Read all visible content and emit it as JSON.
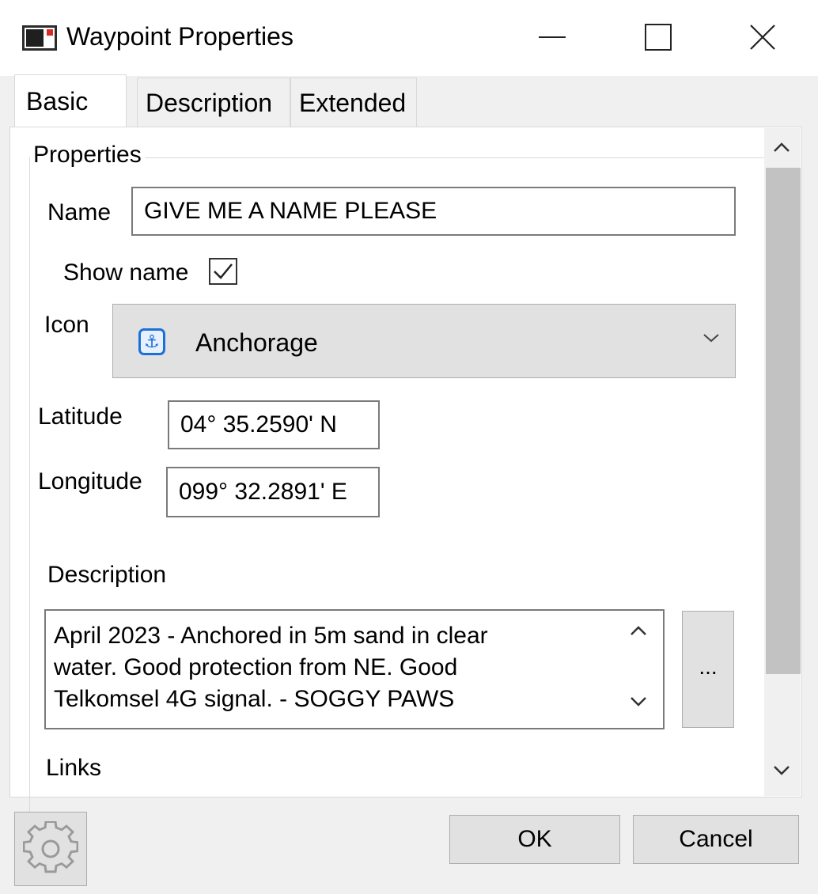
{
  "window": {
    "title": "Waypoint Properties",
    "app_icon": "waypoint-app-icon"
  },
  "title_controls": {
    "minimize": "minimize-icon",
    "maximize": "maximize-icon",
    "close": "close-icon"
  },
  "tabs": [
    {
      "label": "Basic",
      "active": true
    },
    {
      "label": "Description",
      "active": false
    },
    {
      "label": "Extended",
      "active": false
    }
  ],
  "properties": {
    "group_label": "Properties",
    "name_label": "Name",
    "name_value": "GIVE ME A NAME PLEASE",
    "show_name_label": "Show name",
    "show_name_checked": true,
    "icon_label": "Icon",
    "icon_value": "Anchorage",
    "icon_symbol": "anchor-icon",
    "latitude_label": "Latitude",
    "latitude_value": "04° 35.2590' N",
    "longitude_label": "Longitude",
    "longitude_value": "099° 32.2891' E",
    "description_label": "Description",
    "description_value": "April 2023 - Anchored in 5m sand in clear\nwater. Good protection from NE. Good\nTelkomsel 4G signal. - SOGGY PAWS",
    "more_button_label": "...",
    "links_label": "Links"
  },
  "footer": {
    "settings_icon": "gear-icon",
    "ok_label": "OK",
    "cancel_label": "Cancel"
  },
  "colors": {
    "window_bg": "#f0f0f0",
    "panel_bg": "#ffffff",
    "button_bg": "#e1e1e1",
    "anchor_blue": "#1d6fd8"
  }
}
